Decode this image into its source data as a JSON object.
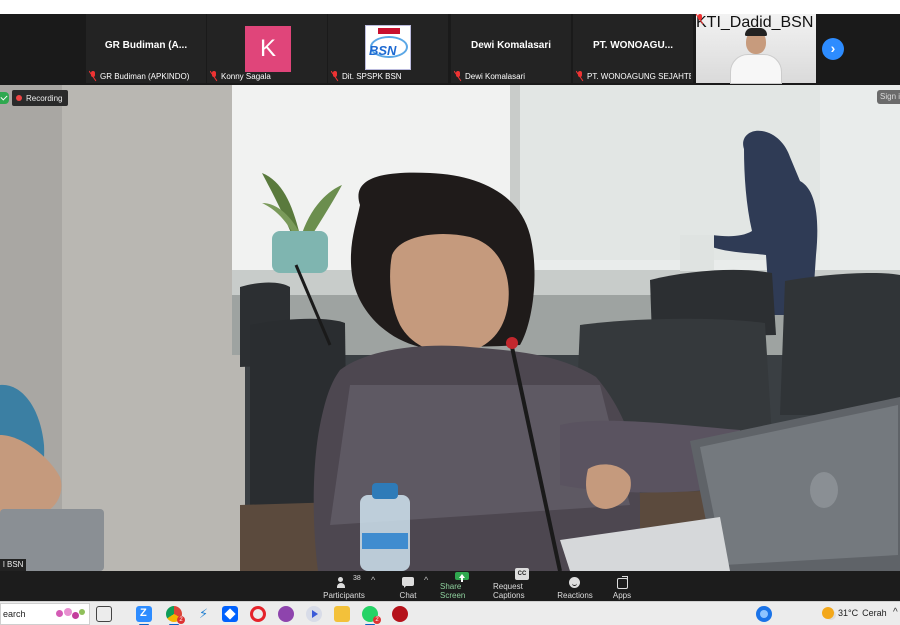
{
  "thumbnails": [
    {
      "display": "GR Budiman (A...",
      "footer": "GR Budiman (APKINDO)"
    },
    {
      "display": "K",
      "footer": "Konny Sagala"
    },
    {
      "display": "BSN",
      "footer": "Dit. SPSPK BSN"
    },
    {
      "display": "Dewi Komalasari",
      "footer": "Dewi Komalasari"
    },
    {
      "display": "PT. WONOAGU...",
      "footer": "PT. WONOAGUNG SEJAHTER..."
    },
    {
      "display": "",
      "footer": "KTI_Dadid_BSN"
    }
  ],
  "colors": {
    "avatar_k": "#e0457a",
    "accent_blue": "#2d8cff",
    "share_green": "#2fa84f",
    "recording_red": "#e44"
  },
  "main": {
    "recording_label": "Recording",
    "sign_in_label": "Sign in",
    "speaker_name": "l BSN"
  },
  "toolbar": {
    "participants_label": "Participants",
    "participants_count": "38",
    "chat_label": "Chat",
    "share_label": "Share Screen",
    "captions_label": "Request Captions",
    "reactions_label": "Reactions",
    "apps_label": "Apps"
  },
  "taskbar": {
    "search_label": "earch",
    "weather_temp": "31°C",
    "weather_desc": "Cerah",
    "icons": [
      "zoom-icon",
      "chrome-icon",
      "vscode-icon",
      "dropbox-icon",
      "opera-icon",
      "app-purple-icon",
      "media-player-icon",
      "file-explorer-icon",
      "whatsapp-icon",
      "app-red-icon"
    ],
    "whatsapp_badge": "2",
    "chrome_badge": "2"
  }
}
